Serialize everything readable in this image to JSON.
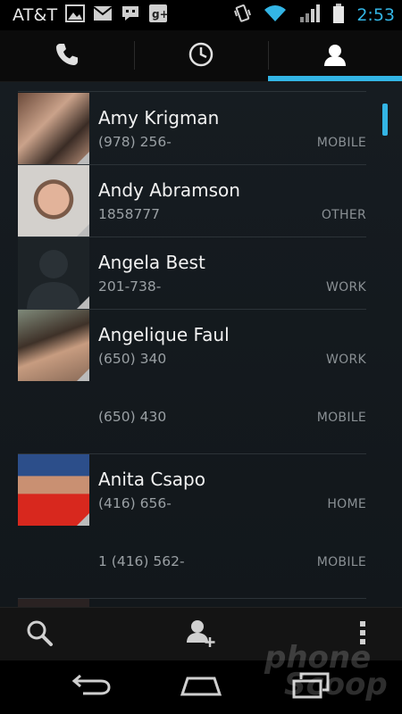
{
  "status_bar": {
    "carrier": "AT&T",
    "time": "2:53",
    "notification_icons": [
      "gallery-icon",
      "gmail-icon",
      "talk-icon",
      "google-plus-icon"
    ],
    "system_icons": [
      "vibrate-icon",
      "wifi-icon",
      "signal-icon",
      "battery-icon"
    ]
  },
  "tabs": [
    {
      "name": "phone",
      "icon": "phone-icon",
      "active": false
    },
    {
      "name": "recent",
      "icon": "clock-icon",
      "active": false
    },
    {
      "name": "contacts",
      "icon": "person-icon",
      "active": true
    }
  ],
  "contacts": [
    {
      "name": "Amy Krigman",
      "number": "(978) 256-",
      "type": "MOBILE"
    },
    {
      "name": "Andy Abramson",
      "number": "1858777",
      "type": "OTHER"
    },
    {
      "name": "Angela Best",
      "number": "201-738-",
      "type": "WORK"
    },
    {
      "name": "Angelique Faul",
      "number": "(650) 340",
      "type": "WORK",
      "extra": {
        "number": "(650) 430",
        "type": "MOBILE"
      }
    },
    {
      "name": "Anita Csapo",
      "number": "(416) 656-",
      "type": "HOME",
      "extra": {
        "number": "1 (416) 562-",
        "type": "MOBILE"
      }
    }
  ],
  "action_bar": {
    "icons": [
      "search-icon",
      "add-contact-icon",
      "overflow-menu-icon"
    ]
  },
  "nav_bar": {
    "icons": [
      "back-icon",
      "home-icon",
      "recent-apps-icon"
    ]
  },
  "watermark": {
    "line1": "phone",
    "line2": "Scoop"
  }
}
